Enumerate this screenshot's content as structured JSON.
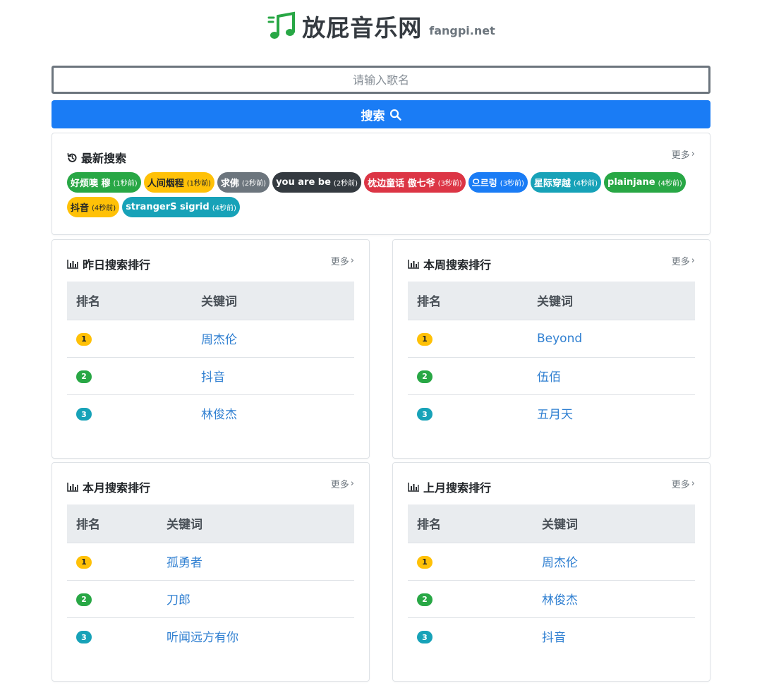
{
  "header": {
    "title": "放屁音乐网",
    "domain": "fangpi.net",
    "logo_icon": "music-note-icon",
    "logo_color": "#28a745"
  },
  "search": {
    "placeholder": "请输入歌名",
    "button_label": "搜索",
    "button_icon": "search-icon",
    "button_color": "#1a7cf5"
  },
  "recent": {
    "title": "最新搜索",
    "icon": "history-icon",
    "more_label": "更多",
    "tags": [
      {
        "text": "好烦噢 穆",
        "ago": "(1秒前)",
        "color": "green"
      },
      {
        "text": "人间烟程",
        "ago": "(1秒前)",
        "color": "yellow"
      },
      {
        "text": "求佛",
        "ago": "(2秒前)",
        "color": "gray"
      },
      {
        "text": "you are be",
        "ago": "(2秒前)",
        "color": "dark"
      },
      {
        "text": "枕边童话 傲七爷",
        "ago": "(3秒前)",
        "color": "red"
      },
      {
        "text": "으르렁",
        "ago": "(3秒前)",
        "color": "blue"
      },
      {
        "text": "星际穿越",
        "ago": "(4秒前)",
        "color": "teal"
      },
      {
        "text": "plainjane",
        "ago": "(4秒前)",
        "color": "green"
      },
      {
        "text": "抖音",
        "ago": "(4秒前)",
        "color": "yellow"
      },
      {
        "text": "strangerS sigrid",
        "ago": "(4秒前)",
        "color": "teal"
      }
    ]
  },
  "rankings": [
    {
      "title": "昨日搜索排行",
      "more_label": "更多",
      "col_rank": "排名",
      "col_keyword": "关键词",
      "rows": [
        {
          "rank": "1",
          "keyword": "周杰伦"
        },
        {
          "rank": "2",
          "keyword": "抖音"
        },
        {
          "rank": "3",
          "keyword": "林俊杰"
        }
      ]
    },
    {
      "title": "本周搜索排行",
      "more_label": "更多",
      "col_rank": "排名",
      "col_keyword": "关键词",
      "rows": [
        {
          "rank": "1",
          "keyword": "Beyond"
        },
        {
          "rank": "2",
          "keyword": "伍佰"
        },
        {
          "rank": "3",
          "keyword": "五月天"
        }
      ]
    },
    {
      "title": "本月搜索排行",
      "more_label": "更多",
      "col_rank": "排名",
      "col_keyword": "关键词",
      "rows": [
        {
          "rank": "1",
          "keyword": "孤勇者"
        },
        {
          "rank": "2",
          "keyword": "刀郎"
        },
        {
          "rank": "3",
          "keyword": "听闻远方有你"
        }
      ]
    },
    {
      "title": "上月搜索排行",
      "more_label": "更多",
      "col_rank": "排名",
      "col_keyword": "关键词",
      "rows": [
        {
          "rank": "1",
          "keyword": "周杰伦"
        },
        {
          "rank": "2",
          "keyword": "林俊杰"
        },
        {
          "rank": "3",
          "keyword": "抖音"
        }
      ]
    }
  ]
}
